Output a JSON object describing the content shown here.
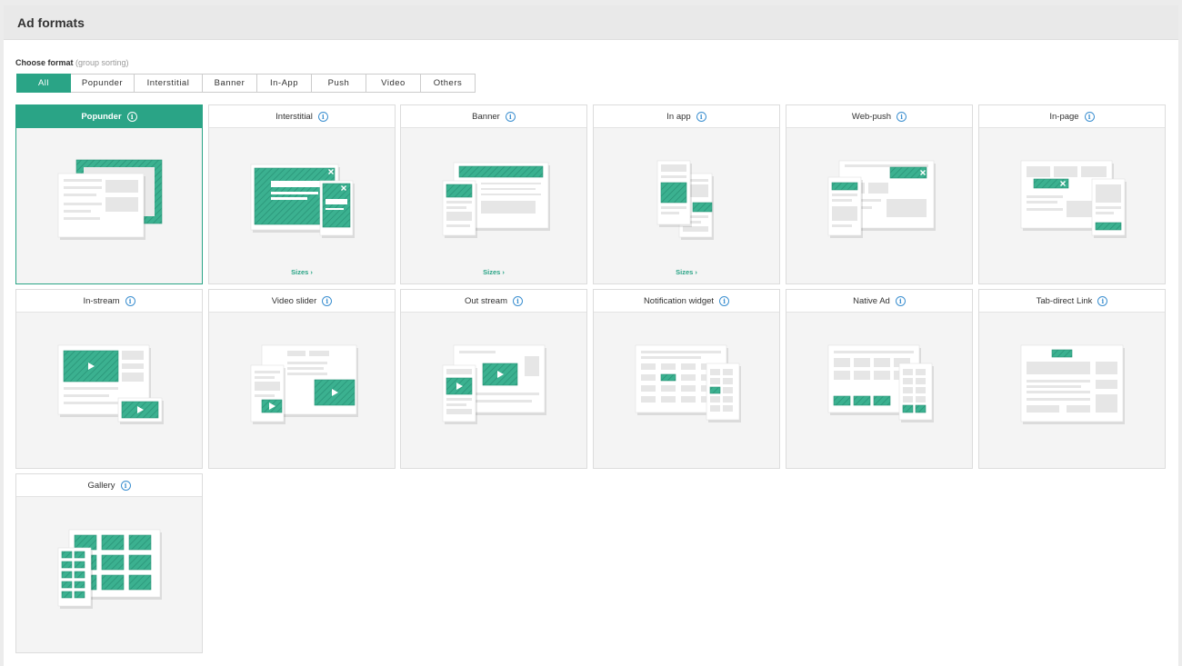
{
  "header": {
    "title": "Ad formats"
  },
  "filter": {
    "label": "Choose format",
    "hint": "(group sorting)",
    "tabs": [
      {
        "label": "All",
        "active": true
      },
      {
        "label": "Popunder"
      },
      {
        "label": "Interstitial"
      },
      {
        "label": "Banner"
      },
      {
        "label": "In-App"
      },
      {
        "label": "Push"
      },
      {
        "label": "Video"
      },
      {
        "label": "Others"
      }
    ]
  },
  "info_glyph": "i",
  "formats": [
    {
      "title": "Popunder",
      "active": true,
      "illustration": "popunder-illustration"
    },
    {
      "title": "Interstitial",
      "sizes": "Sizes ›",
      "illustration": "interstitial-illustration"
    },
    {
      "title": "Banner",
      "sizes": "Sizes ›",
      "illustration": "banner-illustration"
    },
    {
      "title": "In app",
      "sizes": "Sizes ›",
      "illustration": "in-app-illustration"
    },
    {
      "title": "Web-push",
      "illustration": "web-push-illustration"
    },
    {
      "title": "In-page",
      "illustration": "in-page-illustration"
    },
    {
      "title": "In-stream",
      "illustration": "in-stream-illustration"
    },
    {
      "title": "Video slider",
      "illustration": "video-slider-illustration"
    },
    {
      "title": "Out stream",
      "illustration": "out-stream-illustration"
    },
    {
      "title": "Notification widget",
      "illustration": "notification-widget-illustration"
    },
    {
      "title": "Native Ad",
      "illustration": "native-ad-illustration"
    },
    {
      "title": "Tab-direct Link",
      "illustration": "tab-direct-link-illustration"
    },
    {
      "title": "Gallery",
      "illustration": "gallery-illustration"
    }
  ],
  "colors": {
    "accent": "#2aa486",
    "info": "#3b8fd0",
    "card_bg": "#f4f4f4",
    "screen_fill": "#e8e8e8"
  }
}
